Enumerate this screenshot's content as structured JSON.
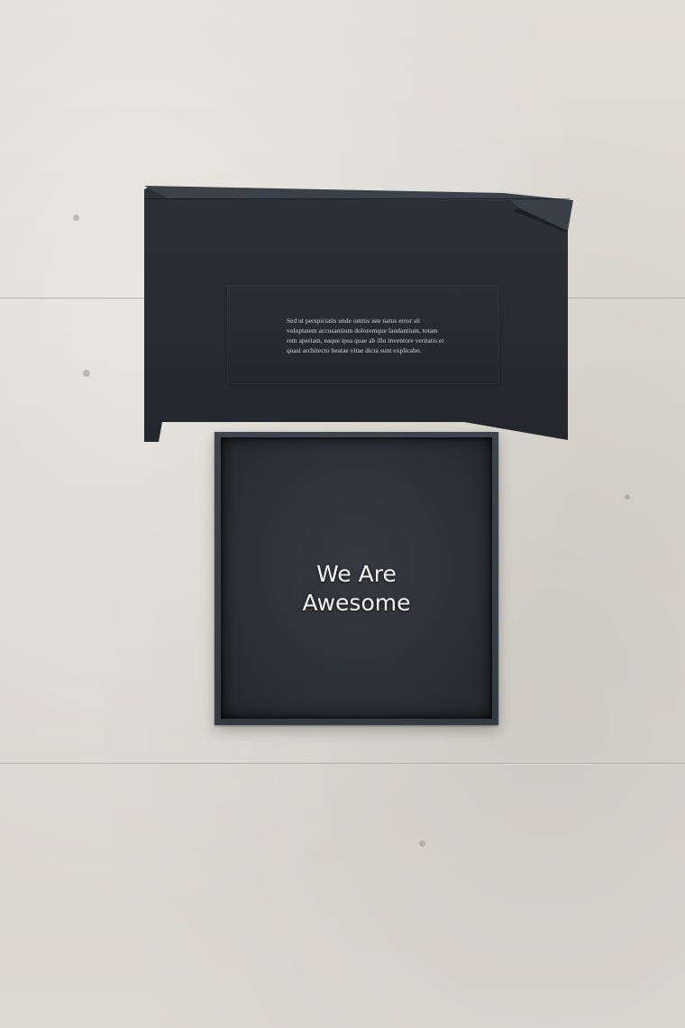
{
  "lid": {
    "text": "Sed ut perspiciatis unde omnis iste natus error sit voluptatem accusantium doloremque laudantium, totam rem aperiam, eaque ipsa quae ab illo inventore veritatis et quasi architecto beatae vitae dicta sunt explicabo."
  },
  "box": {
    "line1": "We Are",
    "line2": "Awesome"
  },
  "colors": {
    "wall": "#dcd9d1",
    "box": "#2f343a",
    "text": "#f1f1f1"
  }
}
